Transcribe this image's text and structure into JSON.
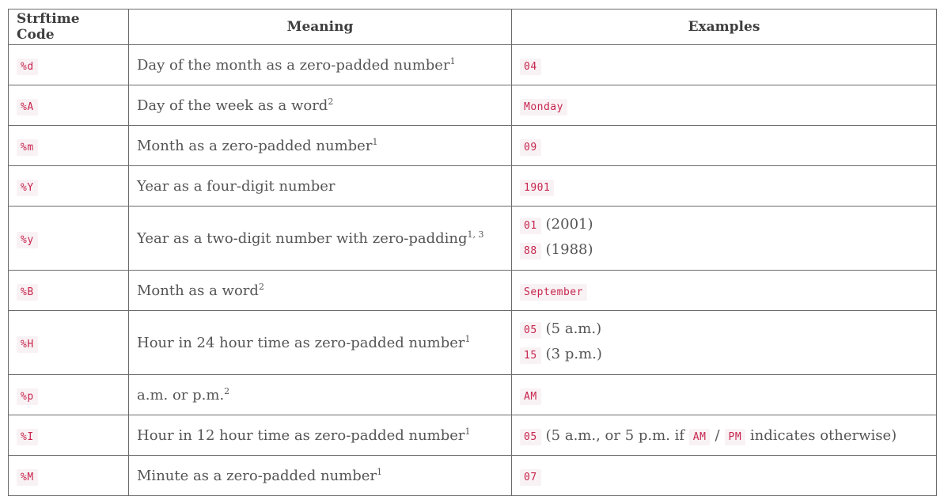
{
  "headers": {
    "code": "Strftime Code",
    "meaning": "Meaning",
    "examples": "Examples"
  },
  "rows": [
    {
      "code": "%d",
      "meaning": "Day of the month as a zero-padded number",
      "sup": "1",
      "examples": [
        {
          "code": "04",
          "note": ""
        }
      ]
    },
    {
      "code": "%A",
      "meaning": "Day of the week as a word",
      "sup": "2",
      "examples": [
        {
          "code": "Monday",
          "note": ""
        }
      ]
    },
    {
      "code": "%m",
      "meaning": "Month as a zero-padded number",
      "sup": "1",
      "examples": [
        {
          "code": "09",
          "note": ""
        }
      ]
    },
    {
      "code": "%Y",
      "meaning": "Year as a four-digit number",
      "sup": "",
      "examples": [
        {
          "code": "1901",
          "note": ""
        }
      ]
    },
    {
      "code": "%y",
      "meaning": "Year as a two-digit number with zero-padding",
      "sup": "1, 3",
      "examples": [
        {
          "code": "01",
          "note": "(2001)"
        },
        {
          "code": "88",
          "note": "(1988)"
        }
      ]
    },
    {
      "code": "%B",
      "meaning": "Month as a word",
      "sup": "2",
      "examples": [
        {
          "code": "September",
          "note": ""
        }
      ]
    },
    {
      "code": "%H",
      "meaning": "Hour in 24 hour time as zero-padded number",
      "sup": "1",
      "examples": [
        {
          "code": "05",
          "note": "(5 a.m.)"
        },
        {
          "code": "15",
          "note": "(3 p.m.)"
        }
      ]
    },
    {
      "code": "%p",
      "meaning": "a.m. or p.m.",
      "sup": "2",
      "examples": [
        {
          "code": "AM",
          "note": ""
        }
      ]
    },
    {
      "code": "%I",
      "meaning": "Hour in 12 hour time as zero-padded number",
      "sup": "1",
      "examples": [],
      "complex_example": {
        "code": "05",
        "text_before": "(5 a.m., or 5 p.m. if",
        "code_am": "AM",
        "slash": "/",
        "code_pm": "PM",
        "text_after": "indicates otherwise)"
      }
    },
    {
      "code": "%M",
      "meaning": "Minute as a zero-padded number",
      "sup": "1",
      "examples": [
        {
          "code": "07",
          "note": ""
        }
      ]
    }
  ]
}
